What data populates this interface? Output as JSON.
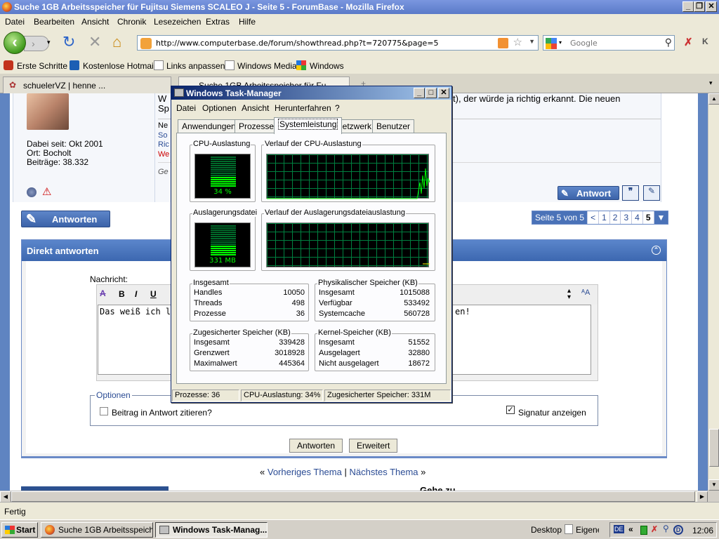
{
  "firefox": {
    "title": "Suche 1GB Arbeitsspeicher für Fujitsu Siemens SCALEO J - Seite 5 - ForumBase - Mozilla Firefox",
    "menu": [
      "Datei",
      "Bearbeiten",
      "Ansicht",
      "Chronik",
      "Lesezeichen",
      "Extras",
      "Hilfe"
    ],
    "url": "http://www.computerbase.de/forum/showthread.php?t=720775&page=5",
    "search_placeholder": "Google",
    "bookmarks": [
      "Erste Schritte",
      "Kostenlose Hotmail",
      "Links anpassen",
      "Windows Media",
      "Windows"
    ],
    "tabs": [
      "schuelerVZ | henne ...",
      "Suche 1GB Arbeitsspeicher für Fu..."
    ],
    "status": "Fertig"
  },
  "forum": {
    "post_text_line1": "W",
    "post_text_tail": "t), der würde ja richtig erkannt. Die neuen",
    "post_text_line2": "Sp",
    "user_since": "Dabei seit: Okt 2001",
    "user_location": "Ort: Bocholt",
    "user_posts": "Beiträge: 38.332",
    "sig_lines": [
      "Ne",
      "So",
      "Ric",
      "We"
    ],
    "sig_extra": "Ge",
    "antwort_label": "Antwort",
    "antworten_label": "Antworten",
    "pager": {
      "label": "Seite 5 von 5",
      "items": [
        "<",
        "1",
        "2",
        "3",
        "4",
        "5"
      ]
    },
    "direkt_title": "Direkt antworten",
    "nachricht_label": "Nachricht:",
    "message_text_start": "Das weiß ich leic",
    "message_text_end": "en!",
    "optionen_legend": "Optionen",
    "option_quote": "Beitrag in Antwort zitieren?",
    "option_signature": "Signatur anzeigen",
    "btn_antworten": "Antworten",
    "btn_erweitert": "Erweitert",
    "prev_thread": "Vorheriges Thema",
    "next_thread": "Nächstes Thema",
    "nav_left_quote": "«",
    "nav_sep": "|",
    "nav_right_quote": "»",
    "bottom_text": "Gehe zu"
  },
  "taskmanager": {
    "title": "Windows Task-Manager",
    "menu": [
      "Datei",
      "Optionen",
      "Ansicht",
      "Herunterfahren",
      "?"
    ],
    "tabs": [
      "Anwendungen",
      "Prozesse",
      "Systemleistung",
      "Netzwerk",
      "Benutzer"
    ],
    "active_tab": "Systemleistung",
    "cpu_label": "CPU-Auslastung",
    "cpu_value": "34 %",
    "cpu_percent": 34,
    "cpu_history_label": "Verlauf der CPU-Auslastung",
    "pf_label": "Auslagerungsdatei",
    "pf_value": "331 MB",
    "pf_history_label": "Verlauf der Auslagerungsdateiauslastung",
    "totals": {
      "title": "Insgesamt",
      "rows": [
        [
          "Handles",
          "10050"
        ],
        [
          "Threads",
          "498"
        ],
        [
          "Prozesse",
          "36"
        ]
      ]
    },
    "physical": {
      "title": "Physikalischer Speicher (KB)",
      "rows": [
        [
          "Insgesamt",
          "1015088"
        ],
        [
          "Verfügbar",
          "533492"
        ],
        [
          "Systemcache",
          "560728"
        ]
      ]
    },
    "commit": {
      "title": "Zugesicherter Speicher (KB)",
      "rows": [
        [
          "Insgesamt",
          "339428"
        ],
        [
          "Grenzwert",
          "3018928"
        ],
        [
          "Maximalwert",
          "445364"
        ]
      ]
    },
    "kernel": {
      "title": "Kernel-Speicher (KB)",
      "rows": [
        [
          "Insgesamt",
          "51552"
        ],
        [
          "Ausgelagert",
          "32880"
        ],
        [
          "Nicht ausgelagert",
          "18672"
        ]
      ]
    },
    "status": [
      "Prozesse: 36",
      "CPU-Auslastung: 34%",
      "Zugesicherter Speicher: 331M"
    ]
  },
  "taskbar": {
    "start": "Start",
    "tasks": [
      "Suche 1GB Arbeitsspeich...",
      "Windows Task-Manag..."
    ],
    "desktop": "Desktop",
    "eigene": "Eigene",
    "lang": "DE",
    "chevron": "«",
    "time": "12:06"
  }
}
